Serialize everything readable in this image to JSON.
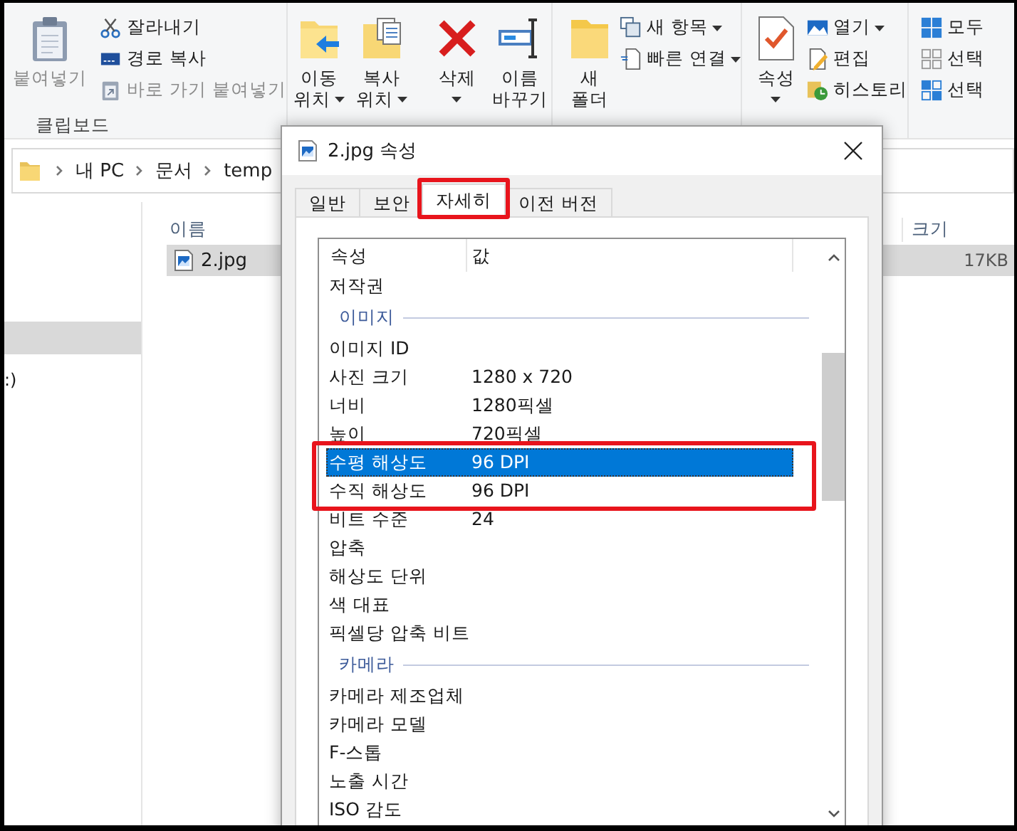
{
  "ribbon": {
    "groups": [
      {
        "label": "클립보드",
        "commands": [
          {
            "kind": "large",
            "lines": [
              "붙여넣기"
            ],
            "dropdown": false,
            "disabled": true
          },
          {
            "kind": "small",
            "lines": [
              "잘라내기"
            ],
            "dropdown": false,
            "disabled": false
          },
          {
            "kind": "small",
            "lines": [
              "경로 복사"
            ],
            "dropdown": false,
            "disabled": false
          },
          {
            "kind": "small",
            "lines": [
              "바로 가기 붙여넣기"
            ],
            "dropdown": false,
            "disabled": true
          }
        ]
      },
      {
        "commands": [
          {
            "kind": "large",
            "lines": [
              "이동",
              "위치"
            ],
            "dropdown": true,
            "disabled": false
          },
          {
            "kind": "large",
            "lines": [
              "복사",
              "위치"
            ],
            "dropdown": true,
            "disabled": false
          },
          {
            "kind": "large",
            "lines": [
              "삭제"
            ],
            "dropdown": true,
            "disabled": false
          },
          {
            "kind": "large",
            "lines": [
              "이름",
              "바꾸기"
            ],
            "dropdown": false,
            "disabled": false
          }
        ]
      },
      {
        "commands": [
          {
            "kind": "large",
            "lines": [
              "새",
              "폴더"
            ],
            "dropdown": false,
            "disabled": false
          },
          {
            "kind": "small",
            "lines": [
              "새 항목"
            ],
            "dropdown": true,
            "disabled": false
          },
          {
            "kind": "small",
            "lines": [
              "빠른 연결"
            ],
            "dropdown": true,
            "disabled": false
          }
        ]
      },
      {
        "commands": [
          {
            "kind": "large",
            "lines": [
              "속성"
            ],
            "dropdown": true,
            "disabled": false
          },
          {
            "kind": "small",
            "lines": [
              "열기"
            ],
            "dropdown": true,
            "disabled": false
          },
          {
            "kind": "small",
            "lines": [
              "편집"
            ],
            "dropdown": false,
            "disabled": false
          },
          {
            "kind": "small",
            "lines": [
              "히스토리"
            ],
            "dropdown": false,
            "disabled": false
          }
        ]
      },
      {
        "commands": [
          {
            "kind": "small",
            "lines": [
              "모두"
            ],
            "dropdown": false,
            "disabled": false
          },
          {
            "kind": "small",
            "lines": [
              "선택"
            ],
            "dropdown": false,
            "disabled": false
          },
          {
            "kind": "small",
            "lines": [
              "선택"
            ],
            "dropdown": false,
            "disabled": false
          }
        ]
      }
    ]
  },
  "address_bar": {
    "path": [
      "내 PC",
      "문서",
      "temp"
    ]
  },
  "nav_pane": {
    "items": [
      {
        "selected": true
      },
      {
        "label": ":)",
        "selected": false
      }
    ]
  },
  "file_list": {
    "columns": [
      "이름",
      "크기"
    ],
    "rows": [
      {
        "name": "2.jpg",
        "size": "17KB",
        "selected": true
      }
    ]
  },
  "dialog": {
    "title": "2.jpg 속성",
    "tabs": [
      {
        "label": "일반",
        "selected": false,
        "highlighted": false
      },
      {
        "label": "보안",
        "selected": false,
        "highlighted": false
      },
      {
        "label": "자세히",
        "selected": true,
        "highlighted": true
      },
      {
        "label": "이전 버전",
        "selected": false,
        "highlighted": false
      }
    ],
    "columns": [
      "속성",
      "값"
    ],
    "rows": [
      {
        "kind": "property",
        "name": "저작권",
        "selected": false,
        "highlighted": false
      },
      {
        "kind": "section",
        "name": "이미지"
      },
      {
        "kind": "property",
        "name": "이미지 ID",
        "selected": false,
        "highlighted": false
      },
      {
        "kind": "property",
        "name": "사진 크기",
        "value": "1280 x 720",
        "selected": false,
        "highlighted": false
      },
      {
        "kind": "property",
        "name": "너비",
        "value": "1280픽셀",
        "selected": false,
        "highlighted": false
      },
      {
        "kind": "property",
        "name": "높이",
        "value": "720픽셀",
        "selected": false,
        "highlighted": false
      },
      {
        "kind": "property",
        "name": "수평 해상도",
        "value": "96 DPI",
        "selected": true,
        "highlighted": true
      },
      {
        "kind": "property",
        "name": "수직 해상도",
        "value": "96 DPI",
        "selected": false,
        "highlighted": true
      },
      {
        "kind": "property",
        "name": "비트 수준",
        "value": "24",
        "selected": false,
        "highlighted": false
      },
      {
        "kind": "property",
        "name": "압축",
        "selected": false,
        "highlighted": false
      },
      {
        "kind": "property",
        "name": "해상도 단위",
        "selected": false,
        "highlighted": false
      },
      {
        "kind": "property",
        "name": "색 대표",
        "selected": false,
        "highlighted": false
      },
      {
        "kind": "property",
        "name": "픽셀당 압축 비트",
        "selected": false,
        "highlighted": false
      },
      {
        "kind": "section",
        "name": "카메라"
      },
      {
        "kind": "property",
        "name": "카메라 제조업체",
        "selected": false,
        "highlighted": false
      },
      {
        "kind": "property",
        "name": "카메라 모델",
        "selected": false,
        "highlighted": false
      },
      {
        "kind": "property",
        "name": "F-스톱",
        "selected": false,
        "highlighted": false
      },
      {
        "kind": "property",
        "name": "노출 시간",
        "selected": false,
        "highlighted": false
      },
      {
        "kind": "property",
        "name": "ISO 감도",
        "selected": false,
        "highlighted": false
      }
    ]
  }
}
